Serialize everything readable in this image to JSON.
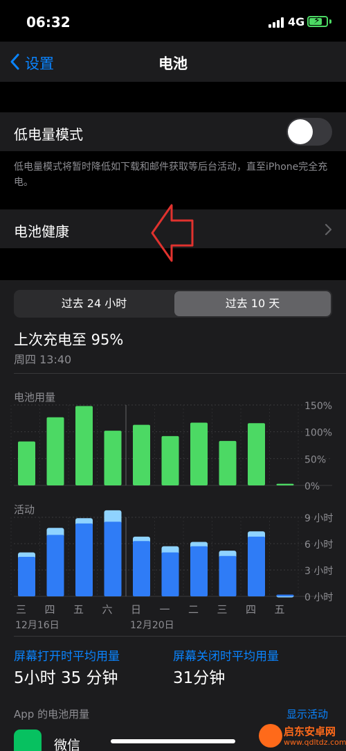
{
  "status_bar": {
    "time": "06:32",
    "network": "4G",
    "battery_level": 0.75
  },
  "nav": {
    "back_label": "设置",
    "title": "电池"
  },
  "low_power": {
    "label": "低电量模式",
    "enabled": false,
    "footnote": "低电量模式将暂时降低如下载和邮件获取等后台活动，直至iPhone完全充电。"
  },
  "battery_health": {
    "label": "电池健康"
  },
  "segmented": {
    "options": [
      "过去 24 小时",
      "过去 10 天"
    ],
    "selected": "过去 10 天"
  },
  "last_charge": {
    "title": "上次充电至 95%",
    "time": "周四 13:40"
  },
  "colors": {
    "usage_bar": "#4cd964",
    "activity_on": "#2f7cf6",
    "activity_off": "#8fd3ff",
    "accent": "#0a84ff",
    "annotation_arrow": "#e0322e"
  },
  "chart_data": [
    {
      "type": "bar",
      "title": "电池用量",
      "categories": [
        "三",
        "四",
        "五",
        "六",
        "日",
        "一",
        "二",
        "三",
        "四",
        "五"
      ],
      "values": [
        82,
        127,
        148,
        102,
        113,
        92,
        117,
        83,
        116,
        3
      ],
      "y_ticks": [
        "150%",
        "100%",
        "50%",
        "0%"
      ],
      "ylim": [
        0,
        150
      ]
    },
    {
      "type": "bar",
      "title": "活动",
      "categories": [
        "三",
        "四",
        "五",
        "六",
        "日",
        "一",
        "二",
        "三",
        "四",
        "五"
      ],
      "series": [
        {
          "values": [
            4.5,
            7.0,
            8.3,
            8.5,
            6.3,
            5.0,
            5.7,
            4.6,
            6.8,
            0.2
          ]
        },
        {
          "values": [
            0.5,
            0.8,
            0.6,
            1.3,
            0.5,
            0.7,
            0.5,
            0.6,
            0.6,
            0.0
          ]
        }
      ],
      "y_ticks": [
        "9 小时",
        "6 小时",
        "3 小时",
        "0 小时"
      ],
      "ylim": [
        0,
        9
      ],
      "dates": [
        "12月16日",
        "12月20日"
      ]
    }
  ],
  "averages": {
    "screen_on_label": "屏幕打开时平均用量",
    "screen_on_value": "5小时 35 分钟",
    "screen_off_label": "屏幕关闭时平均用量",
    "screen_off_value": "31分钟"
  },
  "app_usage": {
    "header": "App 的电池用量",
    "show_activity": "显示活动",
    "apps": [
      {
        "name": "微信"
      }
    ]
  },
  "watermark": {
    "title": "启东安卓网",
    "url": "www.qdltdz.com"
  }
}
